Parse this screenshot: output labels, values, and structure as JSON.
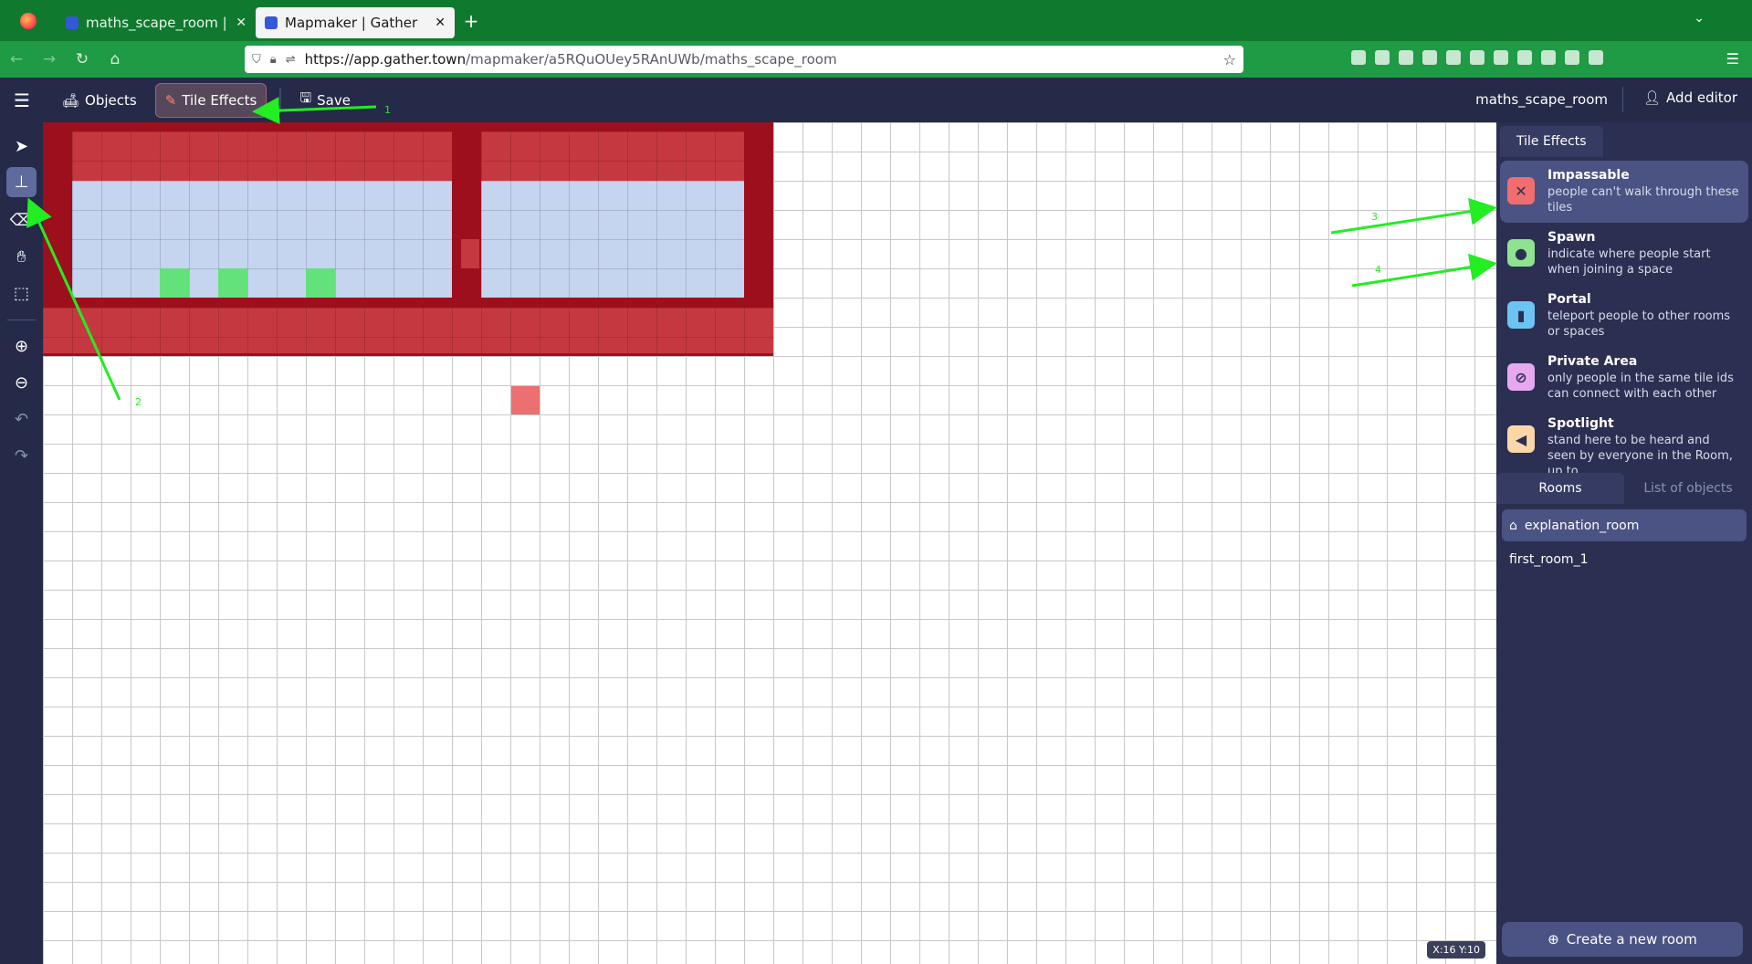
{
  "browser": {
    "tabs": [
      {
        "label": "maths_scape_room | Gat",
        "active": false
      },
      {
        "label": "Mapmaker | Gather",
        "active": true
      }
    ],
    "new_tab_glyph": "+",
    "url_host": "https://app.gather.town",
    "url_rest": "/mapmaker/a5RQuOUey5RAnUWb/maths_scape_room"
  },
  "appbar": {
    "objects_label": "Objects",
    "tile_effects_label": "Tile Effects",
    "save_label": "Save",
    "room_name": "maths_scape_room",
    "add_editor_label": "Add editor"
  },
  "panel": {
    "tab_label": "Tile Effects",
    "effects": [
      {
        "title": "Impassable",
        "desc": "people can't walk through these tiles",
        "color": "#f26d6d",
        "glyph": "✕"
      },
      {
        "title": "Spawn",
        "desc": "indicate where people start when joining a space",
        "color": "#8fe28f",
        "glyph": "⬤"
      },
      {
        "title": "Portal",
        "desc": "teleport people to other rooms or spaces",
        "color": "#6cc4f2",
        "glyph": "▮"
      },
      {
        "title": "Private Area",
        "desc": "only people in the same tile ids can connect with each other",
        "color": "#e6a9ef",
        "glyph": "⊘"
      },
      {
        "title": "Spotlight",
        "desc": "stand here to be heard and seen by everyone in the Room, up to",
        "color": "#fbd7a8",
        "glyph": "◀"
      }
    ],
    "rooms_tab": "Rooms",
    "objects_tab": "List of objects",
    "rooms": [
      {
        "name": "explanation_room",
        "active": true
      },
      {
        "name": "first_room_1",
        "active": false
      }
    ],
    "create_room_label": "Create a new room"
  },
  "canvas": {
    "coord_readout": "X:16   Y:10"
  },
  "annotations": {
    "n1": "1",
    "n2": "2",
    "n3": "3",
    "n4": "4",
    "color": "#22ee22"
  }
}
